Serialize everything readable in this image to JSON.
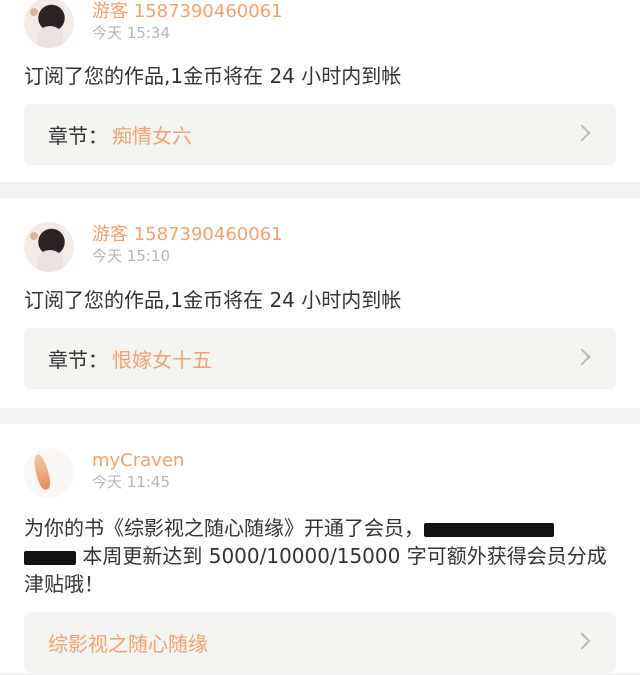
{
  "notifications": [
    {
      "username": "游客 1587390460061",
      "time": "今天 15:34",
      "message": "订阅了您的作品,1金币将在 24 小时内到帐",
      "chapter_label": "章节：",
      "chapter_title": "痴情女六",
      "avatar": "anime-girl-avatar"
    },
    {
      "username": "游客 1587390460061",
      "time": "今天 15:10",
      "message": "订阅了您的作品,1金币将在 24 小时内到帐",
      "chapter_label": "章节：",
      "chapter_title": "恨嫁女十五",
      "avatar": "anime-girl-avatar"
    },
    {
      "username": "myCraven",
      "time": "今天 11:45",
      "message_part1": "为你的书《综影视之随心随缘》开通了会员，",
      "message_part2": "本周更新达到 5000/10000/15000 字可额外获得会员分成津贴哦！",
      "link_title": "综影视之随心随缘",
      "avatar": "koi-fish-avatar"
    }
  ],
  "colors": {
    "accent": "#f0a372",
    "text": "#333333",
    "muted": "#b6b6b6",
    "panel": "#f4f4f1",
    "background": "#f2f2f2"
  },
  "icons": {
    "chevron": "chevron-right-icon"
  }
}
